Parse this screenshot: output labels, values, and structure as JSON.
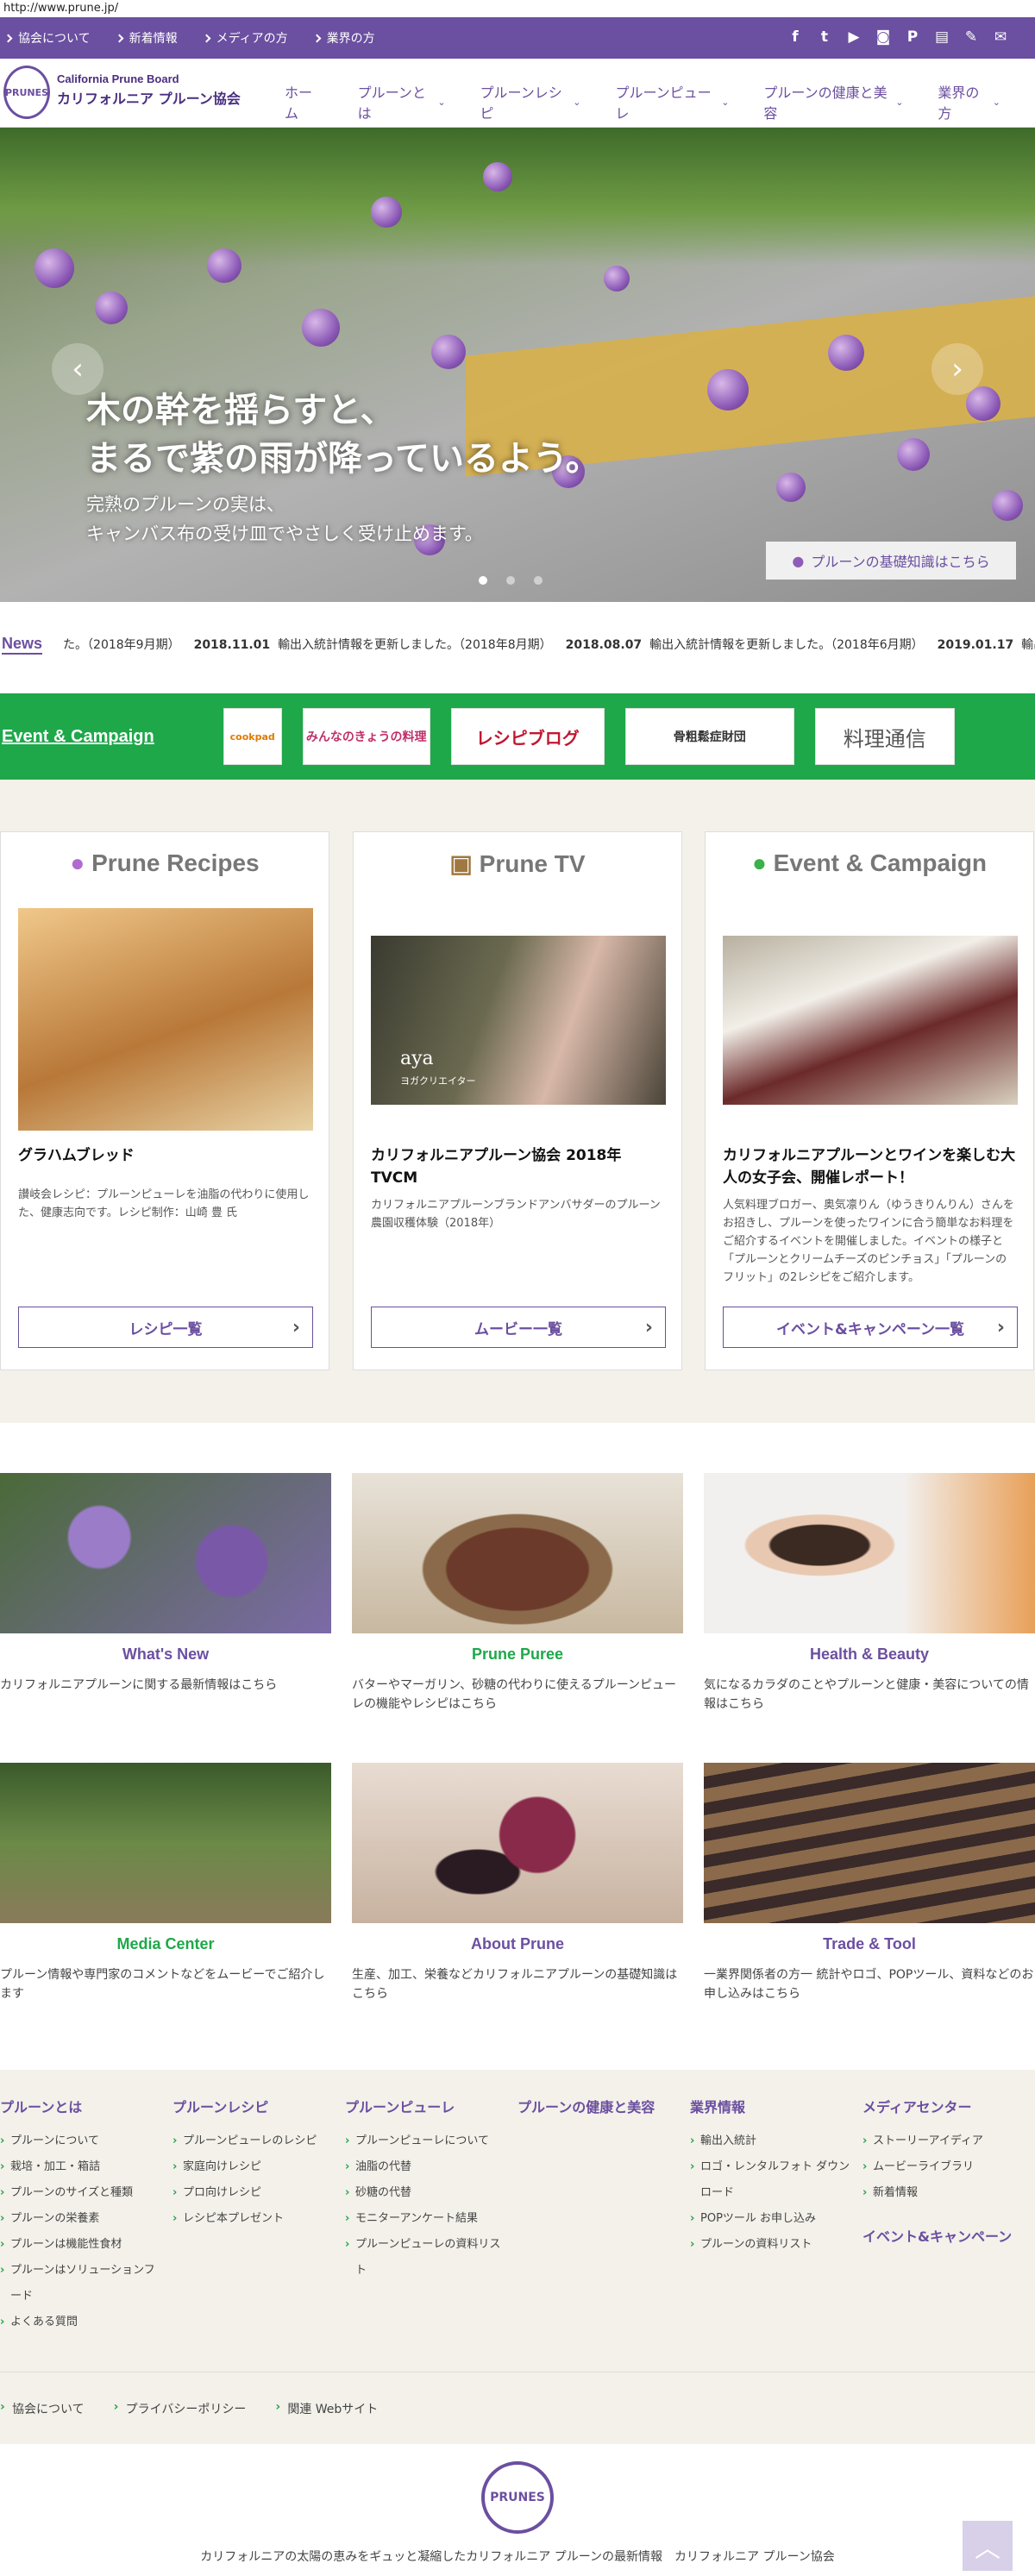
{
  "browser": {
    "url": "http://www.prune.jp/"
  },
  "topbar": {
    "links": [
      "協会について",
      "新着情報",
      "メディアの方",
      "業界の方"
    ],
    "social_icons": [
      "facebook-icon",
      "twitter-icon",
      "youtube-icon",
      "instagram-icon",
      "pinterest-icon",
      "blog-icon",
      "pen-icon",
      "mail-icon"
    ]
  },
  "header": {
    "logo_text": "PRUNES",
    "brand_en": "California Prune Board",
    "brand_ja": "カリフォルニア プルーン協会",
    "nav": [
      {
        "label": "ホーム",
        "dropdown": false
      },
      {
        "label": "プルーンとは",
        "dropdown": true
      },
      {
        "label": "プルーンレシピ",
        "dropdown": true
      },
      {
        "label": "プルーンピューレ",
        "dropdown": true
      },
      {
        "label": "プルーンの健康と美容",
        "dropdown": true
      },
      {
        "label": "業界の方",
        "dropdown": true
      }
    ]
  },
  "hero": {
    "headline_1": "木の幹を揺らすと、",
    "headline_2": "まるで紫の雨が降っているよう。",
    "sub_1": "完熟のプルーンの実は、",
    "sub_2": "キャンバス布の受け皿でやさしく受け止めます。",
    "button": "プルーンの基礎知識はこちら",
    "prev": "‹",
    "next": "›",
    "slide_count": 3,
    "active_slide": 1
  },
  "news": {
    "label": "News",
    "items": [
      {
        "date": "",
        "text": "た。（2018年9月期）"
      },
      {
        "date": "2018.11.01",
        "text": "輸出入統計情報を更新しました。（2018年8月期）"
      },
      {
        "date": "2018.08.07",
        "text": "輸出入統計情報を更新しました。（2018年6月期）"
      },
      {
        "date": "2019.01.17",
        "text": "輸出"
      }
    ]
  },
  "event_bar": {
    "title": "Event & Campaign",
    "partners": [
      "cookpad",
      "みんなのきょうの料理",
      "レシピブログ",
      "骨粗鬆症財団",
      "料理通信"
    ]
  },
  "cards": [
    {
      "heading": "Prune Recipes",
      "title": "グラハムブレッド",
      "desc": "讃岐会レシピ：プルーンピューレを油脂の代わりに使用した、健康志向です。レシピ制作：山崎 豊 氏",
      "link": "レシピ一覧"
    },
    {
      "heading": "Prune TV",
      "image_caption": "aya",
      "image_subcaption": "ヨガクリエイター",
      "title": "カリフォルニアプルーン協会 2018年TVCM",
      "desc": "カリフォルニアプルーンブランドアンバサダーのプルーン農園収穫体験（2018年）",
      "link": "ムービー一覧"
    },
    {
      "heading": "Event & Campaign",
      "title": "カリフォルニアプルーンとワインを楽しむ大人の女子会、開催レポート！",
      "desc": "人気料理ブロガー、奥気凛りん（ゆうきりんりん）さんをお招きし、プルーンを使ったワインに合う簡単なお料理をご紹介するイベントを開催しました。イベントの様子と「プルーンとクリームチーズのピンチョス」「プルーンのフリット」の2レシピをご紹介します。",
      "link": "イベント&キャンペーン一覧"
    }
  ],
  "tiles": [
    {
      "name": "What's New",
      "color": "#6b4fa0",
      "text": "カリフォルニアプルーンに関する最新情報はこちら"
    },
    {
      "name": "Prune Puree",
      "color": "#1ea84a",
      "text": "バターやマーガリン、砂糖の代わりに使えるプルーンピューレの機能やレシピはこちら"
    },
    {
      "name": "Health & Beauty",
      "color": "#6b4fa0",
      "text": "気になるカラダのことやプルーンと健康・美容についての情報はこちら"
    },
    {
      "name": "Media Center",
      "color": "#1ea84a",
      "text": "プルーン情報や専門家のコメントなどをムービーでご紹介します"
    },
    {
      "name": "About Prune",
      "color": "#6b4fa0",
      "text": "生産、加工、栄養などカリフォルニアプルーンの基礎知識はこちら"
    },
    {
      "name": "Trade & Tool",
      "color": "#6b4fa0",
      "text": "一業界関係者の方一 統計やロゴ、POPツール、資料などのお申し込みはこちら"
    }
  ],
  "footer_nav": [
    {
      "title": "プルーンとは",
      "items": [
        "プルーンについて",
        "栽培・加工・箱詰",
        "プルーンのサイズと種類",
        "プルーンの栄養素",
        "プルーンは機能性食材",
        "プルーンはソリューションフード",
        "よくある質問"
      ]
    },
    {
      "title": "プルーンレシピ",
      "items": [
        "プルーンピューレのレシピ",
        "家庭向けレシピ",
        "プロ向けレシピ",
        "レシピ本プレゼント"
      ]
    },
    {
      "title": "プルーンピューレ",
      "items": [
        "プルーンピューレについて",
        "油脂の代替",
        "砂糖の代替",
        "モニターアンケート結果",
        "プルーンピューレの資料リスト"
      ]
    },
    {
      "title": "プルーンの健康と美容",
      "items": []
    },
    {
      "title": "業界情報",
      "items": [
        "輸出入統計",
        "ロゴ・レンタルフォト ダウンロード",
        "POPツール お申し込み",
        "プルーンの資料リスト"
      ]
    },
    {
      "title": "メディアセンター",
      "items": [
        "ストーリーアイディア",
        "ムービーライブラリ",
        "新着情報"
      ],
      "extra_title": "イベント&キャンペーン"
    }
  ],
  "footer_bar": [
    "協会について",
    "プライバシーポリシー",
    "関連 Webサイト"
  ],
  "footer": {
    "logo_text": "PRUNES",
    "copyright": "カリフォルニアの太陽の恵みをギュッと凝縮したカリフォルニア プルーンの最新情報　カリフォルニア プルーン協会"
  },
  "back_to_top": "︿"
}
